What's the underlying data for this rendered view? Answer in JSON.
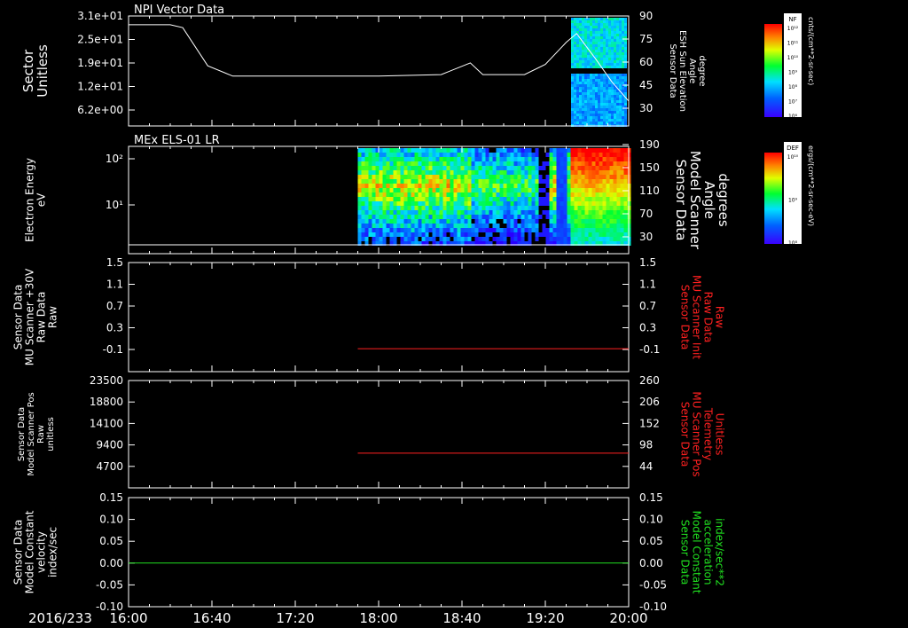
{
  "colors": {
    "axis": "#ffffff",
    "red_series": "#ff2020",
    "green_series": "#20e020",
    "background": "#000000"
  },
  "time_axis": {
    "date_label": "2016/233",
    "ticks": [
      "16:00",
      "16:40",
      "17:20",
      "18:00",
      "18:40",
      "19:20",
      "20:00"
    ]
  },
  "colorbars": [
    {
      "tag": "NF",
      "unit": "cnts/(cm**2-sr-sec)",
      "ticks": [
        "10¹²",
        "10¹¹",
        "10¹⁰",
        "10⁹",
        "10⁸",
        "10⁷",
        "10⁶"
      ]
    },
    {
      "tag": "DEF",
      "unit": "ergs/(cm**2-sr-sec-eV)",
      "ticks": [
        "10¹⁰",
        "10⁹",
        "10⁸"
      ]
    }
  ],
  "chart_data": [
    {
      "type": "line",
      "title": "NPI Vector Data",
      "left_label": [
        "Sector",
        "Unitless"
      ],
      "left_ticks": [
        "3.1e+01",
        "2.5e+01",
        "1.9e+01",
        "1.2e+01",
        "6.2e+00"
      ],
      "right_label": [
        "Sensor Data",
        "ESH Sun Elevation",
        "Angle",
        "degree"
      ],
      "right_ticks": [
        "90",
        "75",
        "60",
        "45",
        "30"
      ],
      "ylim": [
        15,
        90
      ],
      "series": [
        {
          "color": "#ffffff",
          "x": [
            "16:00",
            "16:20",
            "16:26",
            "16:38",
            "16:50",
            "18:00",
            "18:30",
            "18:44",
            "18:50",
            "19:00",
            "19:10",
            "19:20",
            "19:30",
            "19:35",
            "19:44",
            "19:52",
            "20:00"
          ],
          "values": [
            84,
            84,
            82,
            56,
            49,
            49,
            50,
            58,
            50,
            50,
            50,
            57,
            72,
            78,
            61,
            45,
            32
          ]
        }
      ]
    },
    {
      "type": "heatmap",
      "title": "MEx ELS-01 LR",
      "left_label": [
        "Electron Energy",
        "eV"
      ],
      "left_ticks": [
        "10²",
        "10¹"
      ],
      "right_label": [
        "Sensor Data",
        "Model Scanner",
        "Angle",
        "degrees"
      ],
      "right_ticks": [
        "190",
        "150",
        "110",
        "70",
        "30"
      ],
      "ylim": [
        10,
        190
      ]
    },
    {
      "type": "line",
      "title": "",
      "left_label": [
        "Sensor Data",
        "MU Scanner +30V",
        "Raw Data",
        "Raw"
      ],
      "left_ticks": [
        "1.5",
        "1.1",
        "0.7",
        "0.3",
        "-0.1"
      ],
      "right_label": [
        "Sensor Data",
        "MU Scanner Init",
        "Raw Data",
        "Raw"
      ],
      "right_ticks": [
        "1.5",
        "1.1",
        "0.7",
        "0.3",
        "-0.1"
      ],
      "ylim": [
        -0.4,
        1.5
      ],
      "series": [
        {
          "color": "#ff2020",
          "x": [
            "17:50",
            "20:00"
          ],
          "values": [
            0,
            0
          ]
        }
      ]
    },
    {
      "type": "line",
      "title": "",
      "left_label": [
        "Sensor Data",
        "Model Scanner Pos",
        "Raw",
        "unitless"
      ],
      "left_ticks": [
        "23500",
        "18800",
        "14100",
        "9400",
        "4700"
      ],
      "right_label": [
        "Sensor Data",
        "MU Scanner Pos",
        "Telemetry",
        "Unitless"
      ],
      "right_ticks": [
        "260",
        "206",
        "152",
        "98",
        "44"
      ],
      "ylim": [
        0,
        23500
      ],
      "series": [
        {
          "color": "#ff2020",
          "x": [
            "17:50",
            "20:00"
          ],
          "values": [
            7600,
            7600
          ]
        }
      ]
    },
    {
      "type": "line",
      "title": "",
      "left_label": [
        "Sensor Data",
        "Model Constant",
        "velocity",
        "index/sec"
      ],
      "left_ticks": [
        "0.15",
        "0.10",
        "0.05",
        "0.00",
        "-0.05",
        "-0.10"
      ],
      "right_label": [
        "Sensor Data",
        "Model Constant",
        "acceleration",
        "index/sec**2"
      ],
      "right_ticks": [
        "0.15",
        "0.10",
        "0.05",
        "0.00",
        "-0.05",
        "-0.10"
      ],
      "ylim": [
        -0.1,
        0.15
      ],
      "series": [
        {
          "color": "#20e020",
          "x": [
            "16:00",
            "20:00"
          ],
          "values": [
            0,
            0
          ]
        }
      ]
    }
  ]
}
